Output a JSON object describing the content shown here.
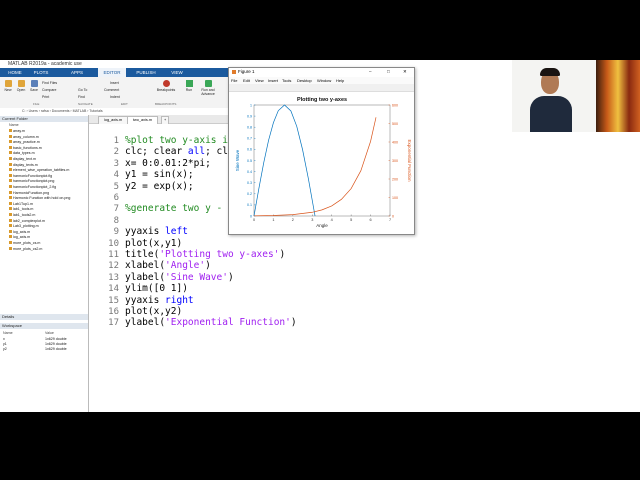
{
  "app": {
    "title": "MATLAB R2019a - academic use"
  },
  "tabs": [
    "HOME",
    "PLOTS",
    "APPS",
    "EDITOR",
    "PUBLISH",
    "VIEW"
  ],
  "active_tab": "EDITOR",
  "ribbon": {
    "file": [
      "New",
      "Open",
      "Save"
    ],
    "file_small": [
      "Find Files",
      "Compare",
      "Print"
    ],
    "navigate": [
      "Go To",
      "Find"
    ],
    "edit": [
      "Insert",
      "Comment",
      "Indent"
    ],
    "breakpoints": "Breakpoints",
    "run": [
      "Run",
      "Run and Advance"
    ],
    "sections": [
      "FILE",
      "NAVIGATE",
      "EDIT",
      "BREAKPOINTS"
    ]
  },
  "address": "C: › Users › rafsa › Documents › MATLAB › Tutorials",
  "current_folder": {
    "header": "Current Folder",
    "column": "Name",
    "files": [
      "array.m",
      "array_column.m",
      "array_practice.m",
      "basic_functions.m",
      "data_types.m",
      "display_text.m",
      "display_texts.m",
      "element_wise_operation_tabfiles.m",
      "harmonicFunctionplot.fig",
      "harmonicFunctionplot.png",
      "harmonicFunctionplot_2.fig",
      "HarmonicFunction.png",
      "Harmonic Function with hold on.png",
      "Lab1Tup1.m",
      "lab1_tools.m",
      "lab1_tools2.m",
      "lab2_complexplot.m",
      "Lab3_plotting.m",
      "log_axis.m",
      "log_axis.m",
      "more_plots_cs.m",
      "more_plots_cs2.m"
    ]
  },
  "details": {
    "header": "Details"
  },
  "workspace": {
    "header": "Workspace",
    "columns": [
      "Name",
      "Value"
    ],
    "vars": [
      {
        "name": "x",
        "value": "1x629 double"
      },
      {
        "name": "y1",
        "value": "1x629 double"
      },
      {
        "name": "y2",
        "value": "1x629 double"
      }
    ]
  },
  "editor": {
    "tabs": [
      "log_axis.m",
      "two_axis.m",
      "+"
    ],
    "active_tab": "two_axis.m",
    "lines": [
      {
        "n": "1",
        "text": "%plot two y-axis in a",
        "cls": "cmt"
      },
      {
        "n": "2",
        "text": "clc; clear all; close",
        "cls": ""
      },
      {
        "n": "3",
        "text": "x= 0:0.01:2*pi;",
        "cls": ""
      },
      {
        "n": "4",
        "text": "y1 = sin(x);",
        "cls": ""
      },
      {
        "n": "5",
        "text": "y2 = exp(x);",
        "cls": ""
      },
      {
        "n": "6",
        "text": "",
        "cls": ""
      },
      {
        "n": "7",
        "text": "%generate two y - axes",
        "cls": "cmt"
      },
      {
        "n": "8",
        "text": "",
        "cls": ""
      },
      {
        "n": "9",
        "text": "yyaxis left",
        "cls": ""
      },
      {
        "n": "10",
        "text": "plot(x,y1)",
        "cls": ""
      },
      {
        "n": "11",
        "text": "title('Plotting two y-axes')",
        "cls": ""
      },
      {
        "n": "12",
        "text": "xlabel('Angle')",
        "cls": ""
      },
      {
        "n": "13",
        "text": "ylabel('Sine Wave')",
        "cls": ""
      },
      {
        "n": "14",
        "text": "ylim([0 1])",
        "cls": ""
      },
      {
        "n": "15",
        "text": "yyaxis right",
        "cls": ""
      },
      {
        "n": "16",
        "text": "plot(x,y2)",
        "cls": ""
      },
      {
        "n": "17",
        "text": "ylabel('Exponential Function')",
        "cls": ""
      }
    ]
  },
  "figure": {
    "window_title": "Figure 1",
    "menu": [
      "File",
      "Edit",
      "View",
      "Insert",
      "Tools",
      "Desktop",
      "Window",
      "Help"
    ],
    "controls": [
      "–",
      "□",
      "✕"
    ]
  },
  "chart_data": {
    "type": "line",
    "title": "Plotting two y-axes",
    "xlabel": "Angle",
    "ylabel_left": "Sine Wave",
    "ylabel_right": "Exponential Function",
    "xlim": [
      0,
      7
    ],
    "ylim_left": [
      0,
      1
    ],
    "ylim_right": [
      0,
      600
    ],
    "x_ticks": [
      "0",
      "1",
      "2",
      "3",
      "4",
      "5",
      "6",
      "7"
    ],
    "y_left_ticks": [
      "0",
      "0.1",
      "0.2",
      "0.3",
      "0.4",
      "0.5",
      "0.6",
      "0.7",
      "0.8",
      "0.9",
      "1"
    ],
    "y_right_ticks": [
      "0",
      "100",
      "200",
      "300",
      "400",
      "500",
      "600"
    ],
    "series": [
      {
        "axis": "left",
        "color": "#0072bd",
        "x": [
          0,
          0.25,
          0.5,
          0.75,
          1.0,
          1.25,
          1.5708,
          1.9,
          2.2,
          2.5,
          2.8,
          3.1416
        ],
        "y": [
          0,
          0.247,
          0.479,
          0.682,
          0.841,
          0.949,
          1.0,
          0.946,
          0.808,
          0.598,
          0.335,
          0.0
        ]
      },
      {
        "axis": "right",
        "color": "#d95319",
        "x": [
          0,
          1,
          2,
          3,
          3.5,
          4,
          4.5,
          5,
          5.5,
          6,
          6.28
        ],
        "y": [
          1,
          2.7,
          7.4,
          20.1,
          33.1,
          54.6,
          90.0,
          148.4,
          244.7,
          403.4,
          533.5
        ]
      }
    ]
  },
  "colors": {
    "tab_bar": "#1b5a9e",
    "left_series": "#0072bd",
    "right_series": "#d95319"
  }
}
